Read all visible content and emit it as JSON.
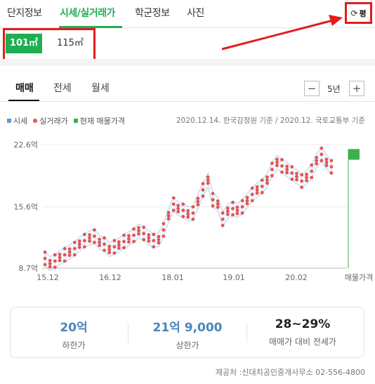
{
  "nav": {
    "tabs": [
      {
        "label": "단지정보",
        "active": false
      },
      {
        "label": "시세/실거래가",
        "active": true
      },
      {
        "label": "학군정보",
        "active": false
      },
      {
        "label": "사진",
        "active": false
      }
    ],
    "unit_toggle_label": "평",
    "refresh_icon": "refresh-icon"
  },
  "areas": {
    "selected": "101㎡",
    "other": "115㎡"
  },
  "subtabs": {
    "items": [
      {
        "label": "매매",
        "active": true
      },
      {
        "label": "전세",
        "active": false
      },
      {
        "label": "월세",
        "active": false
      }
    ],
    "period": "5년",
    "minus": "−",
    "plus": "+"
  },
  "legend": {
    "items": [
      "시세",
      "실거래가",
      "현재 매물가격"
    ],
    "source": "2020.12.14. 한국감정원 기준 / 2020.12. 국토교통부 기준"
  },
  "colors": {
    "accent_green": "#1fae52",
    "trade_dot": "#e25555",
    "price_band": "#5b9bd5",
    "listing_green": "#3cb04c",
    "annotation_red": "#e11d1d"
  },
  "chart_data": {
    "type": "scatter",
    "yticks": [
      "22.6억",
      "15.6억",
      "8.7억"
    ],
    "ytick_values": [
      22.6,
      15.6,
      8.7
    ],
    "xticks": [
      "15.12",
      "16.12",
      "18.01",
      "19.01",
      "20.02",
      "매물가격"
    ],
    "ylim": [
      8.7,
      22.6
    ],
    "series": [
      {
        "name": "실거래가",
        "points": [
          [
            "2015-12",
            9.8
          ],
          [
            "2016-01",
            9.2
          ],
          [
            "2016-02",
            9.5
          ],
          [
            "2016-03",
            9.9
          ],
          [
            "2016-04",
            10.2
          ],
          [
            "2016-05",
            10.5
          ],
          [
            "2016-06",
            10.9
          ],
          [
            "2016-07",
            11.4
          ],
          [
            "2016-08",
            11.8
          ],
          [
            "2016-09",
            12.1
          ],
          [
            "2016-10",
            12.3
          ],
          [
            "2016-11",
            11.6
          ],
          [
            "2016-12",
            11.4
          ],
          [
            "2017-01",
            10.8
          ],
          [
            "2017-02",
            11.1
          ],
          [
            "2017-03",
            11.3
          ],
          [
            "2017-04",
            11.7
          ],
          [
            "2017-05",
            12.0
          ],
          [
            "2017-06",
            12.4
          ],
          [
            "2017-07",
            12.9
          ],
          [
            "2017-08",
            12.6
          ],
          [
            "2017-09",
            12.1
          ],
          [
            "2017-10",
            11.8
          ],
          [
            "2017-11",
            11.9
          ],
          [
            "2017-12",
            13.0
          ],
          [
            "2018-01",
            14.6
          ],
          [
            "2018-02",
            15.9
          ],
          [
            "2018-03",
            15.4
          ],
          [
            "2018-04",
            15.2
          ],
          [
            "2018-05",
            14.8
          ],
          [
            "2018-06",
            14.9
          ],
          [
            "2018-07",
            16.2
          ],
          [
            "2018-08",
            17.5
          ],
          [
            "2018-09",
            18.6
          ],
          [
            "2018-10",
            16.4
          ],
          [
            "2018-11",
            15.9
          ],
          [
            "2018-12",
            14.2
          ],
          [
            "2019-01",
            15.1
          ],
          [
            "2019-02",
            15.4
          ],
          [
            "2019-03",
            15.2
          ],
          [
            "2019-04",
            15.6
          ],
          [
            "2019-05",
            16.3
          ],
          [
            "2019-06",
            17.0
          ],
          [
            "2019-07",
            17.5
          ],
          [
            "2019-08",
            17.9
          ],
          [
            "2019-09",
            18.6
          ],
          [
            "2019-10",
            19.8
          ],
          [
            "2019-11",
            20.6
          ],
          [
            "2019-12",
            20.2
          ],
          [
            "2020-01",
            19.8
          ],
          [
            "2020-02",
            19.4
          ],
          [
            "2020-03",
            19.0
          ],
          [
            "2020-04",
            18.5
          ],
          [
            "2020-05",
            18.9
          ],
          [
            "2020-06",
            19.6
          ],
          [
            "2020-07",
            20.8
          ],
          [
            "2020-08",
            21.5
          ],
          [
            "2020-09",
            20.6
          ],
          [
            "2020-10",
            20.1
          ]
        ]
      },
      {
        "name": "시세",
        "type": "band"
      },
      {
        "name": "현재 매물가격",
        "range": [
          20.9,
          22.1
        ]
      }
    ],
    "annotations": [
      "unit toggle highlighted with red arrow"
    ]
  },
  "stats": [
    {
      "value": "20억",
      "label": "하한가"
    },
    {
      "value": "21억 9,000",
      "label": "상한가"
    },
    {
      "value": "28~29%",
      "label": "매매가 대비 전세가"
    }
  ],
  "footer": "제공처 :신대치공인중개사무소 02-556-4800"
}
